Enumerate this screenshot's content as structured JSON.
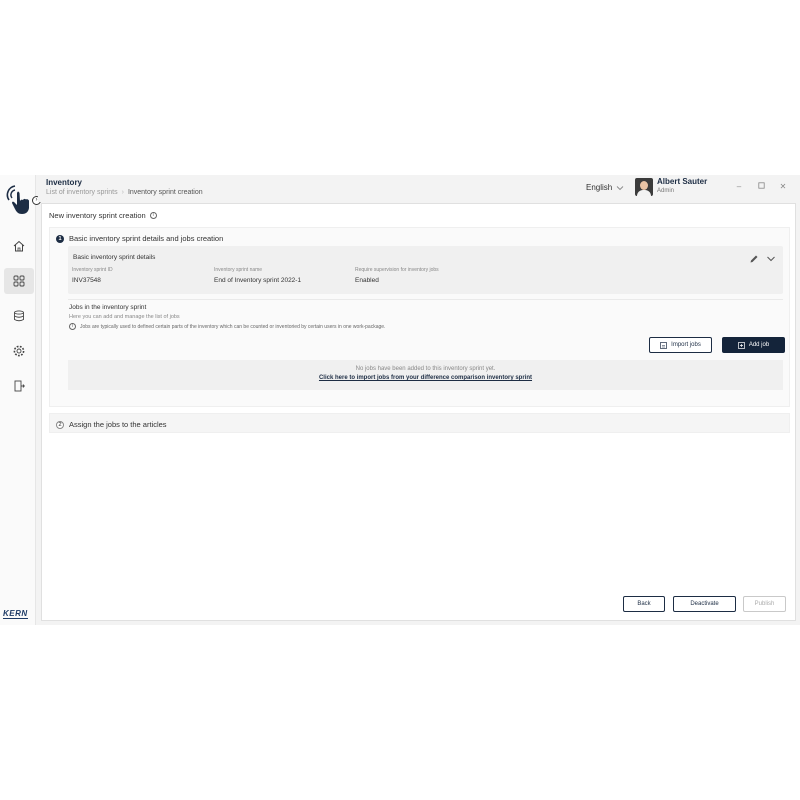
{
  "header": {
    "title": "Inventory",
    "breadcrumb": [
      "List of inventory sprints",
      "Inventory sprint creation"
    ],
    "language": "English",
    "user": {
      "name": "Albert Sauter",
      "role": "Admin"
    }
  },
  "brand": {
    "logo_text": "KERN",
    "accent": "#14243a"
  },
  "page": {
    "title": "New inventory sprint creation",
    "step1": {
      "number": "1",
      "title": "Basic inventory sprint details and jobs creation",
      "details": {
        "title": "Basic inventory sprint details",
        "fields": [
          {
            "label": "Inventory sprint ID",
            "value": "INV37548"
          },
          {
            "label": "Inventory sprint name",
            "value": "End of Inventory sprint 2022-1"
          },
          {
            "label": "Require supervision for inventory jobs",
            "value": "Enabled"
          }
        ]
      },
      "jobs": {
        "title": "Jobs in the inventory sprint",
        "subtitle": "Here you can add and manage the list of jobs",
        "note": "Jobs are typically used to defined certain parts of the inventory which can be counted or inventoried by certain users in one work-package.",
        "import_label": "Import jobs",
        "add_label": "Add job",
        "empty_text": "No jobs have been added to this inventory sprint yet.",
        "empty_link": "Click here to import jobs from your difference comparison inventory sprint"
      }
    },
    "step2": {
      "number": "2",
      "title": "Assign the jobs to the articles"
    }
  },
  "footer": {
    "back": "Back",
    "deactivate": "Deactivate",
    "publish": "Publish"
  }
}
